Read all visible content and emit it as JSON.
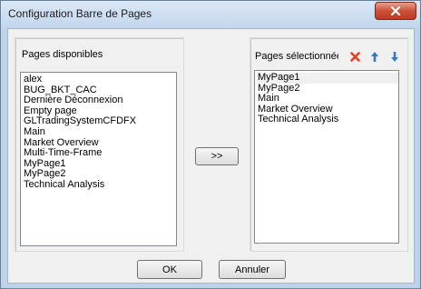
{
  "window": {
    "title": "Configuration Barre de Pages"
  },
  "available": {
    "label": "Pages disponibles",
    "items": [
      "alex",
      "BUG_BKT_CAC",
      "Dernière Déconnexion",
      "Empty page",
      "GLTradingSystemCFDFX",
      "Main",
      "Market Overview",
      "Multi-Time-Frame",
      "MyPage1",
      "MyPage2",
      "Technical Analysis"
    ]
  },
  "selected": {
    "label": "Pages sélectionnées",
    "items": [
      "MyPage1",
      "MyPage2",
      "Main",
      "Market Overview",
      "Technical Analysis"
    ],
    "active_item": "MyPage1"
  },
  "buttons": {
    "move_label": ">>",
    "ok_label": "OK",
    "cancel_label": "Annuler"
  },
  "icons": {
    "close": "close-icon",
    "remove": "red-x-icon",
    "up": "arrow-up-icon",
    "down": "arrow-down-icon"
  },
  "colors": {
    "remove_icon": "#e0402a",
    "arrow_icon": "#2f79cf",
    "titlebar": "#c6d9ee",
    "close_button": "#c8452d"
  }
}
